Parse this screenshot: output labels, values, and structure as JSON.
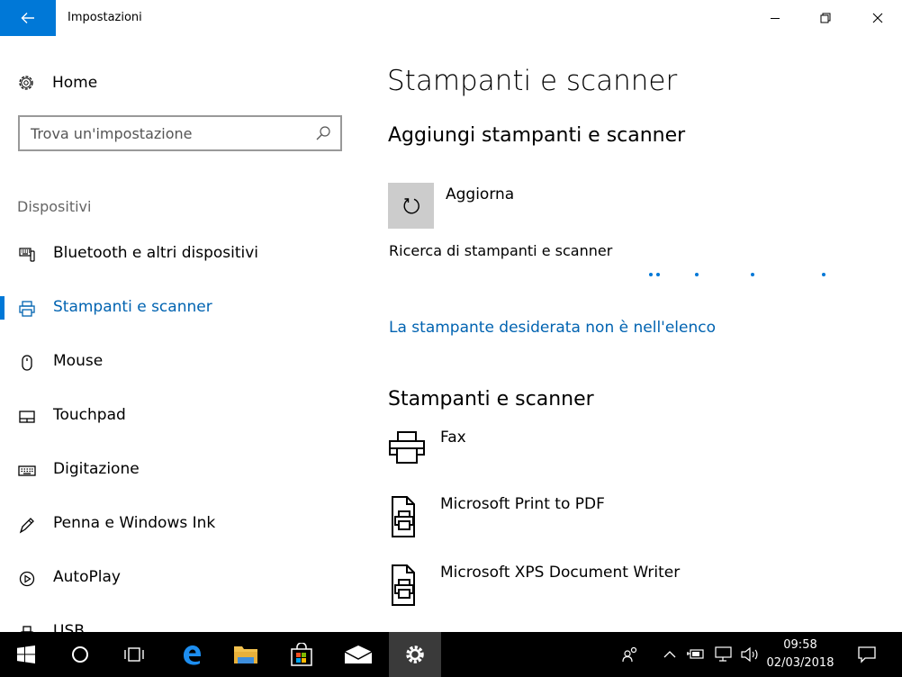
{
  "window": {
    "title": "Impostazioni"
  },
  "sidebar": {
    "home_label": "Home",
    "search_placeholder": "Trova un'impostazione",
    "section_title": "Dispositivi",
    "items": [
      {
        "label": "Bluetooth e altri dispositivi",
        "icon": "bluetooth-devices-icon"
      },
      {
        "label": "Stampanti e scanner",
        "icon": "printer-icon",
        "active": true
      },
      {
        "label": "Mouse",
        "icon": "mouse-icon"
      },
      {
        "label": "Touchpad",
        "icon": "touchpad-icon"
      },
      {
        "label": "Digitazione",
        "icon": "keyboard-icon"
      },
      {
        "label": "Penna e Windows Ink",
        "icon": "pen-icon"
      },
      {
        "label": "AutoPlay",
        "icon": "autoplay-icon"
      },
      {
        "label": "USB",
        "icon": "usb-icon"
      }
    ]
  },
  "main": {
    "page_title": "Stampanti e scanner",
    "add_section_title": "Aggiungi stampanti e scanner",
    "refresh_label": "Aggiorna",
    "searching_text": "Ricerca di stampanti e scanner",
    "missing_printer_link": "La stampante desiderata non è nell'elenco",
    "list_section_title": "Stampanti e scanner",
    "printers": [
      {
        "name": "Fax",
        "icon": "fax-printer-icon"
      },
      {
        "name": "Microsoft Print to PDF",
        "icon": "document-printer-icon"
      },
      {
        "name": "Microsoft XPS Document Writer",
        "icon": "document-printer-icon"
      }
    ]
  },
  "taskbar": {
    "time": "09:58",
    "date": "02/03/2018"
  },
  "colors": {
    "accent": "#0078d7",
    "link": "#0063b1",
    "taskbar": "#000000",
    "taskbar_active": "#3a3a3a"
  }
}
